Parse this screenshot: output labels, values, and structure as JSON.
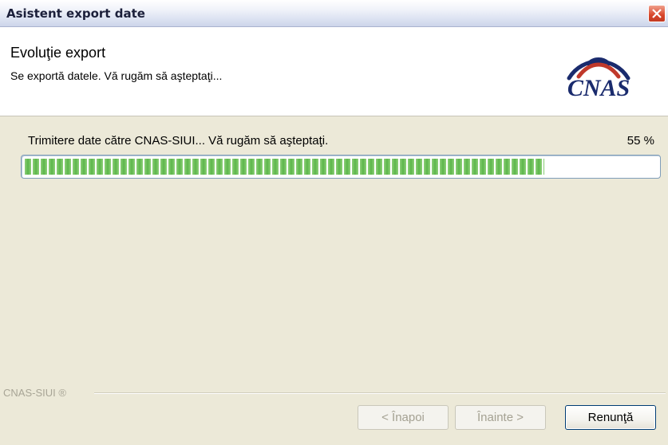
{
  "window": {
    "title": "Asistent export date"
  },
  "header": {
    "title": "Evoluţie export",
    "subtitle": "Se exportă datele. Vă rugăm să aşteptaţi...",
    "logo_text": "CNAS"
  },
  "progress": {
    "label": "Trimitere date către CNAS-SIUI... Vă rugăm să aşteptaţi.",
    "percent_text": "55 %",
    "value": 0.55
  },
  "footer": {
    "brand": "CNAS-SIUI ®"
  },
  "buttons": {
    "back": "< Înapoi",
    "next": "Înainte >",
    "cancel": "Renunţă"
  },
  "colors": {
    "progress_fill": "#5bb64a",
    "logo": "#1a2b6d",
    "logo_accent": "#c0392b"
  },
  "icons": {
    "close": "close-icon",
    "logo": "cnas-logo"
  }
}
